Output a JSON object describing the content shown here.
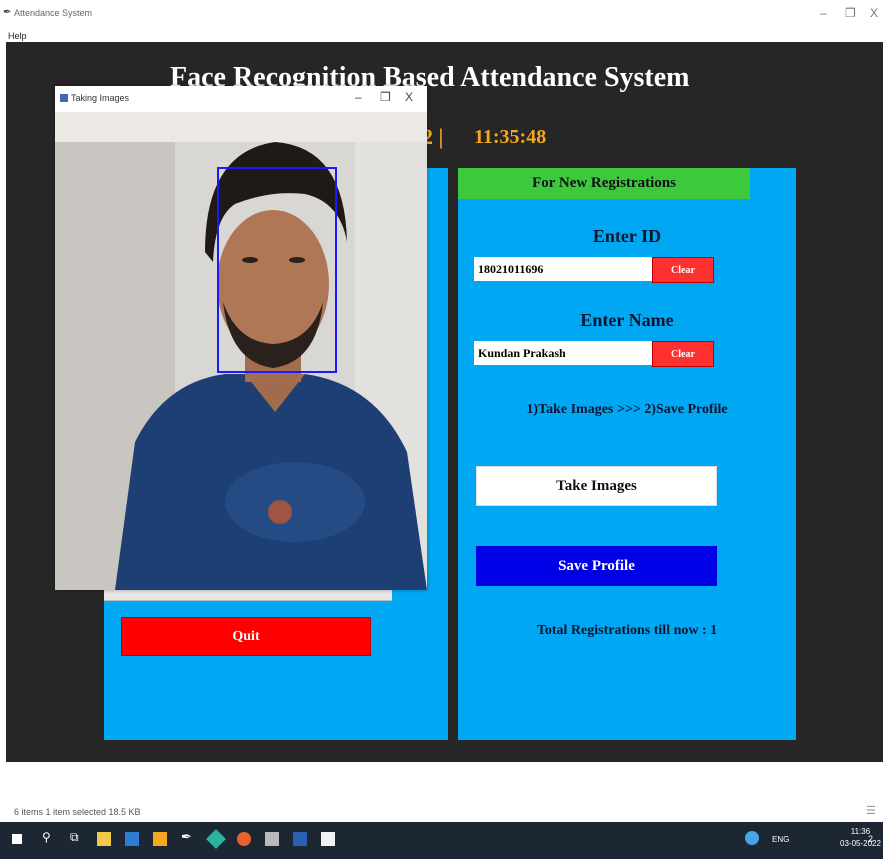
{
  "window": {
    "title": "Attendance System",
    "menu_help": "Help"
  },
  "app": {
    "heading": "Face Recognition Based Attendance System",
    "clock_separator": "2 |",
    "clock_time": "11:35:48"
  },
  "left_panel": {
    "quit_label": "Quit"
  },
  "right_panel": {
    "header": "For New Registrations",
    "enter_id_label": "Enter ID",
    "id_value": "18021011696",
    "id_clear_label": "Clear",
    "enter_name_label": "Enter Name",
    "name_value": "Kundan Prakash",
    "name_clear_label": "Clear",
    "steps_text": "1)Take Images  >>>  2)Save Profile",
    "take_images_label": "Take Images",
    "save_profile_label": "Save Profile",
    "total_registrations": "Total Registrations till now  : 1"
  },
  "camera_window": {
    "title": "Taking Images"
  },
  "status_bar": {
    "text": "6 items    1 item selected  18.5 KB"
  },
  "taskbar": {
    "tray_lang": "ENG",
    "time": "11:36",
    "date": "03-05-2022",
    "notifications": "2"
  },
  "colors": {
    "panel_blue": "#00a8f3",
    "header_green": "#3cc93c",
    "clock_orange": "#f5a623",
    "quit_red": "#ff0000",
    "save_blue": "#0000e6",
    "face_box": "#1a1aff"
  }
}
